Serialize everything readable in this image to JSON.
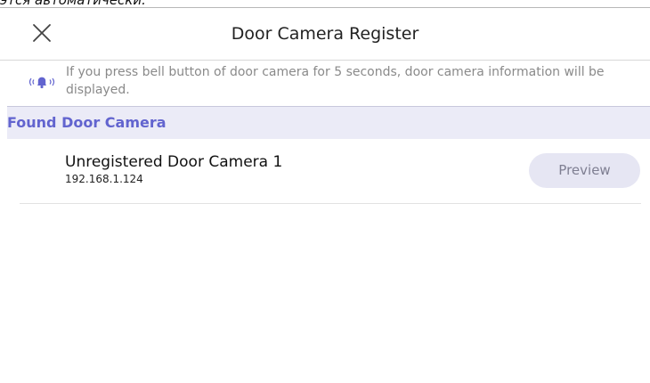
{
  "partial_top_text": "этся автоматически.",
  "header": {
    "close_icon": "close-icon",
    "title": "Door Camera Register"
  },
  "notice": {
    "icon": "bell-ringing-icon",
    "text": "If you press bell button of door camera for 5 seconds, door camera information will be displayed."
  },
  "section": {
    "title": "Found Door Camera"
  },
  "cameras": [
    {
      "name": "Unregistered Door Camera 1",
      "ip": "192.168.1.124",
      "action_label": "Preview"
    }
  ],
  "colors": {
    "accent": "#6264cf",
    "section_bg": "#ebebf7",
    "button_bg": "#e6e6f3",
    "muted_text": "#8a8a8a"
  }
}
